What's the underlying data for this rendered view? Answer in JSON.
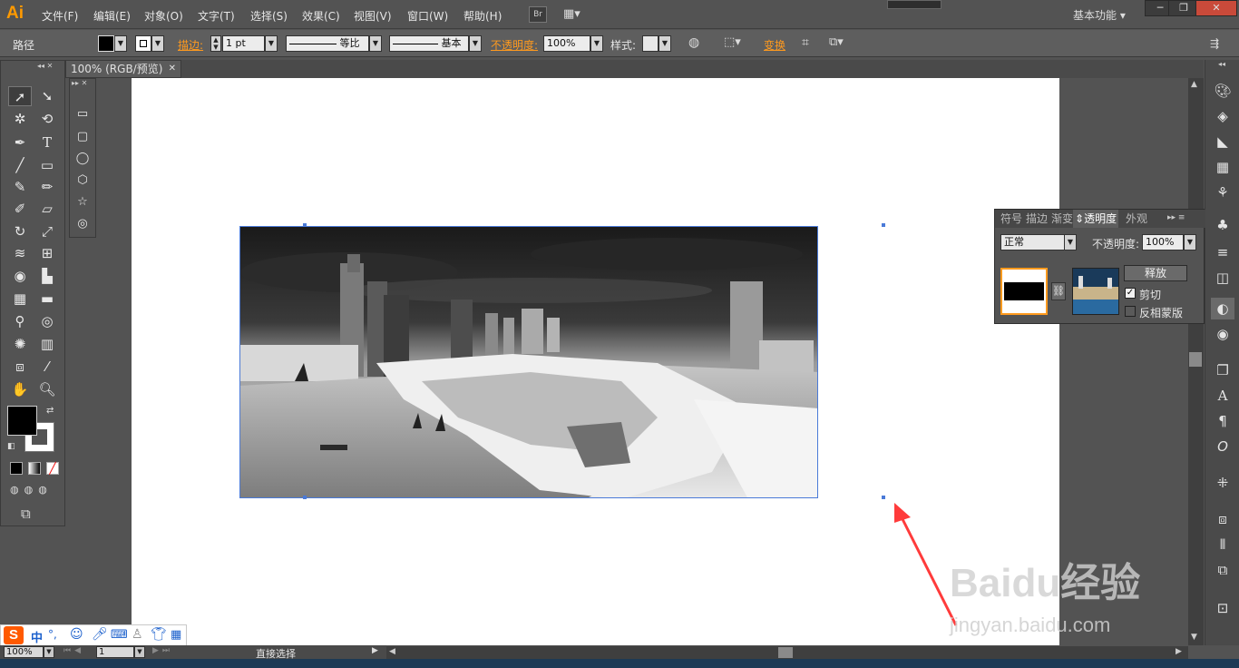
{
  "app": {
    "logo": "Ai",
    "workspace": "基本功能"
  },
  "menu": [
    "文件(F)",
    "编辑(E)",
    "对象(O)",
    "文字(T)",
    "选择(S)",
    "效果(C)",
    "视图(V)",
    "窗口(W)",
    "帮助(H)"
  ],
  "menu_extra": {
    "bridge": "Br"
  },
  "control": {
    "selection_label": "路径",
    "stroke_label": "描边:",
    "stroke_value": "1 pt",
    "stroke_profile": "等比",
    "brush": "基本",
    "opacity_label": "不透明度:",
    "opacity_value": "100%",
    "style_label": "样式:",
    "transform_label": "变换"
  },
  "document": {
    "tab_title": "100% (RGB/预览)"
  },
  "transparency_panel": {
    "tabs": [
      "符号",
      "描边",
      "渐变",
      "透明度",
      "外观"
    ],
    "blend_mode": "正常",
    "opacity_label": "不透明度:",
    "opacity_value": "100%",
    "release_button": "释放",
    "clip_label": "剪切",
    "clip_checked": true,
    "invert_label": "反相蒙版",
    "invert_checked": false
  },
  "status": {
    "zoom": "100%",
    "artboard": "1",
    "tool": "直接选择"
  },
  "ime": {
    "mode": "中"
  },
  "watermark": {
    "brand": "Baidu经验",
    "url": "jingyan.baidu.com"
  },
  "colors": {
    "accent": "#ff9a00",
    "selection": "#4a7ad8",
    "arrow": "#ff3b3b",
    "link_label": "#ff9a1e"
  }
}
